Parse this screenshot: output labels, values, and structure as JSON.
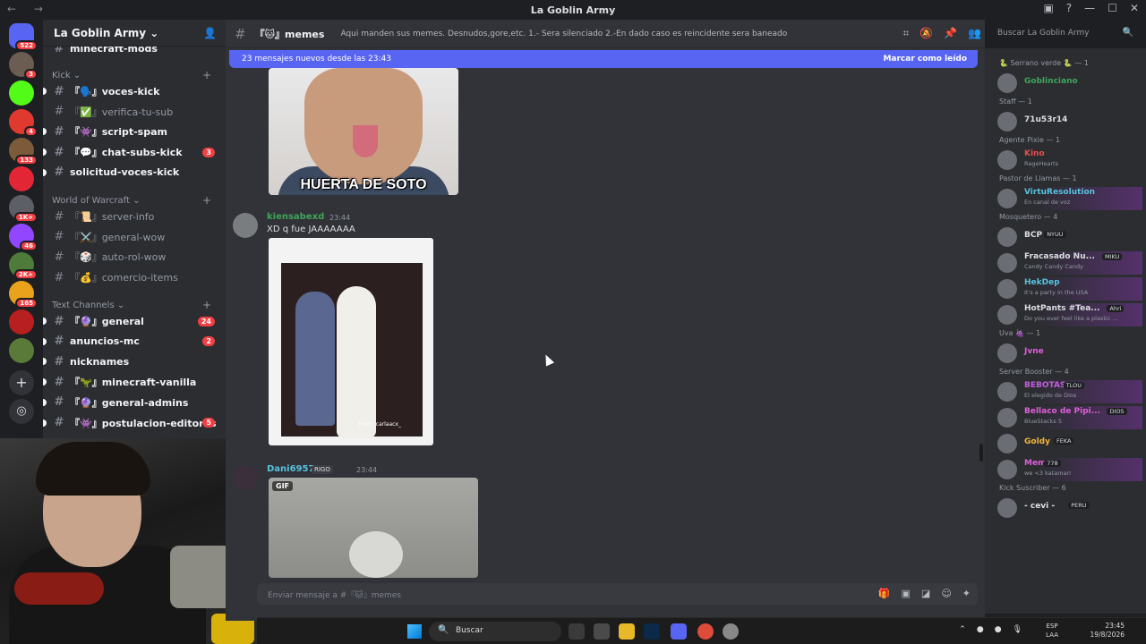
{
  "window": {
    "title": "La Goblin Army",
    "nav": "← →"
  },
  "servers": [
    {
      "badge": "522",
      "color": "#5865f2"
    },
    {
      "badge": "3",
      "color": "#6b5d52"
    },
    {
      "badge": "",
      "color": "#53fc18"
    },
    {
      "badge": "4",
      "color": "#e03a2e"
    },
    {
      "badge": "133",
      "color": "#7b5b3a"
    },
    {
      "badge": "",
      "color": "#e32636"
    },
    {
      "badge": "1K+",
      "color": "#5c6066"
    },
    {
      "badge": "46",
      "color": "#9146ff"
    },
    {
      "badge": "2K+",
      "color": "#4e7a3a"
    },
    {
      "badge": "165",
      "color": "#e8a21b"
    },
    {
      "badge": "",
      "color": "#b81f1f"
    },
    {
      "badge": "",
      "color": "#5a7a3a"
    }
  ],
  "sidebar": {
    "guild_name": "La Goblin Army ⌄",
    "partial_channel": "minecraft-mods",
    "categories": {
      "kick": "Kick ⌄",
      "wow": "World of Warcraft ⌄",
      "text": "Text Channels ⌄"
    },
    "kick_channels": [
      {
        "name": "『🗣️』voces-kick",
        "badge": "",
        "unread": true
      },
      {
        "name": "『✅』verifica-tu-sub",
        "badge": "",
        "unread": false
      },
      {
        "name": "『👾』script-spam",
        "badge": "",
        "unread": true
      },
      {
        "name": "『💬』chat-subs-kick",
        "badge": "3",
        "unread": true
      },
      {
        "name": "solicitud-voces-kick",
        "badge": "",
        "unread": true
      }
    ],
    "wow_channels": [
      {
        "name": "『📜』server-info",
        "badge": "",
        "unread": false
      },
      {
        "name": "『⚔️』general-wow",
        "badge": "",
        "unread": false
      },
      {
        "name": "『🎲』auto-rol-wow",
        "badge": "",
        "unread": false
      },
      {
        "name": "『💰』comercio-items",
        "badge": "",
        "unread": false
      }
    ],
    "text_channels": [
      {
        "name": "『🔮』general",
        "badge": "24",
        "unread": true
      },
      {
        "name": "anuncios-mc",
        "badge": "2",
        "unread": true
      },
      {
        "name": "nicknames",
        "badge": "",
        "unread": true
      },
      {
        "name": "『🦖』minecraft-vanilla",
        "badge": "",
        "unread": true
      },
      {
        "name": "『🔮』general-admins",
        "badge": "",
        "unread": true
      },
      {
        "name": "『👾』postulacion-editores",
        "badge": "5",
        "unread": true
      }
    ]
  },
  "header": {
    "channel": "『🐱』memes",
    "topic": "Aqui manden sus memes. Desnudos,gore,etc. 1.- Sera silenciado 2.-En dado caso es reincidente sera baneado",
    "search_placeholder": "Buscar La Goblin Army"
  },
  "newbar": {
    "text": "23 mensajes nuevos desde las 23:43",
    "mark": "Marcar como leído"
  },
  "messages": {
    "first_image_caption": "HUERTA DE SOTO",
    "m1": {
      "author": "kiensabexd",
      "time": "23:44",
      "text": "XD q fue JAAAAAAA",
      "image_credit": "Foto : carlaacx_"
    },
    "m2": {
      "author": "Dani6957",
      "tag": "RIGO",
      "time": "23:44",
      "gif_label": "GIF"
    }
  },
  "composer": {
    "placeholder": "Enviar mensaje a #『🐱』memes"
  },
  "members": [
    {
      "role": "🐍 Serrano verde 🐍 — 1"
    },
    {
      "name": "Goblinciano",
      "status": "",
      "tag": ""
    },
    {
      "role": "Staff — 1"
    },
    {
      "name": "71u53r14",
      "status": "",
      "tag": ""
    },
    {
      "role": "Agente Pixie — 1"
    },
    {
      "name": "Kino",
      "status": "RageHearts",
      "tag": ""
    },
    {
      "role": "Pastor de Llamas — 1"
    },
    {
      "name": "VirtuResolution",
      "status": "En canal de voz",
      "tag": ""
    },
    {
      "role": "Mosquetero — 4"
    },
    {
      "name": "BCP",
      "status": "",
      "tag": "NYUU"
    },
    {
      "name": "Fracasado Nu...",
      "status": "Candy Candy Candy",
      "tag": "MIKU"
    },
    {
      "name": "HekDep",
      "status": "It's a party in the USA",
      "tag": ""
    },
    {
      "name": "HotPants #Tea...",
      "status": "Do you ever feel like a plastic ...",
      "tag": "Ahri"
    },
    {
      "role": "Uva 🍇 — 1"
    },
    {
      "name": "Jvne",
      "status": "",
      "tag": ""
    },
    {
      "role": "Server Booster — 4"
    },
    {
      "name": "BEBOTAS",
      "status": "El elegido de Dios",
      "tag": "TLOU"
    },
    {
      "name": "Bellaco de Pipi...",
      "status": "BlueStacks 5",
      "tag": "DIOS"
    },
    {
      "name": "Goldy",
      "status": "",
      "tag": "FEKA"
    },
    {
      "name": "Mem",
      "status": "we <3 katamari",
      "tag": "778"
    },
    {
      "role": "Kick Suscriber — 6"
    },
    {
      "name": "- cevi -",
      "status": "",
      "tag": "PERU"
    }
  ],
  "taskbar": {
    "search": "Buscar",
    "lang": "ESP",
    "lang2": "LAA",
    "time": "23:45",
    "date": "19/8/2026"
  },
  "colors": {
    "blurple": "#5865f2",
    "green": "#3fa55b",
    "pink": "#c15fe0"
  }
}
